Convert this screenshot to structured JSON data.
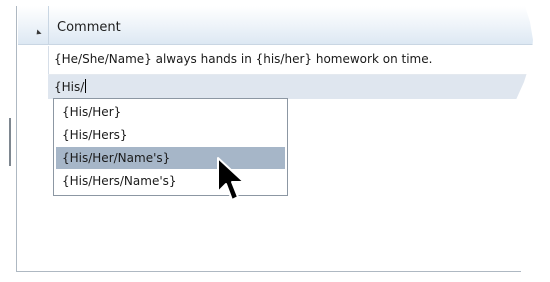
{
  "grid": {
    "column_header": "Comment",
    "rows": [
      {
        "comment": "{He/She/Name} always hands in {his/her} homework on time."
      },
      {
        "comment": "{His/"
      }
    ]
  },
  "autocomplete": {
    "options": [
      {
        "label": "{His/Her}",
        "selected": false
      },
      {
        "label": "{His/Hers}",
        "selected": false
      },
      {
        "label": "{His/Her/Name's}",
        "selected": true
      },
      {
        "label": "{His/Hers/Name's}",
        "selected": false
      }
    ]
  },
  "colors": {
    "header_gradient_bottom": "#dde8f3",
    "editing_row": "#dfe6ef",
    "selected_option": "#a6b6c8",
    "border": "#8c97a3"
  },
  "icons": {
    "sort": "sort-indicator-icon",
    "pointer": "mouse-pointer-icon"
  }
}
